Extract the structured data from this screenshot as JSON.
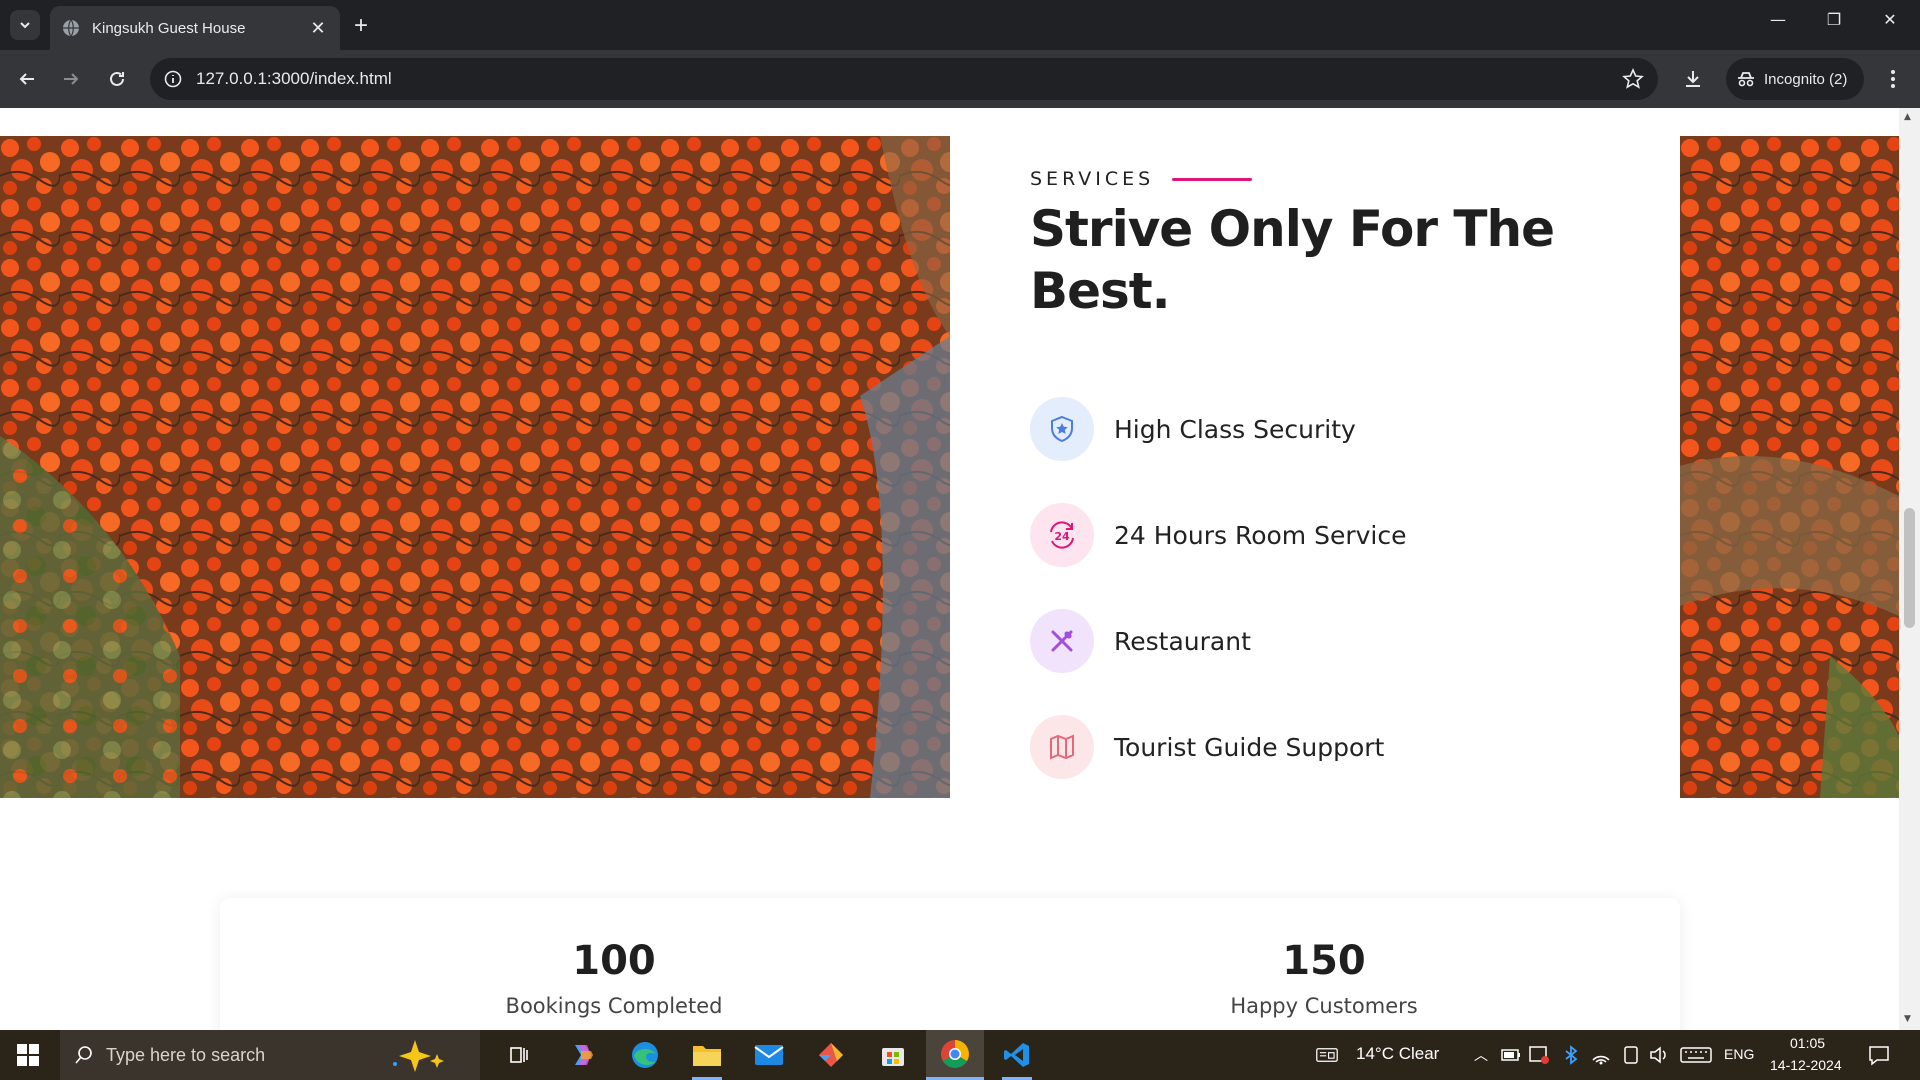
{
  "browser": {
    "tab_title": "Kingsukh Guest House",
    "url": "127.0.0.1:3000/index.html",
    "incognito_label": "Incognito (2)"
  },
  "page": {
    "eyebrow": "SERVICES",
    "headline_line1": "Strive Only For The",
    "headline_line2": "Best.",
    "services": [
      {
        "label": "High Class Security",
        "icon": "shield-star-icon",
        "bg": "#e3edfc",
        "color": "#4b7be5"
      },
      {
        "label": "24 Hours Room Service",
        "icon": "24-hours-icon",
        "bg": "#fde4ef",
        "color": "#e0157a"
      },
      {
        "label": "Restaurant",
        "icon": "fork-knife-icon",
        "bg": "#f1e3fc",
        "color": "#a34ee0"
      },
      {
        "label": "Tourist Guide Support",
        "icon": "map-icon",
        "bg": "#fde6e8",
        "color": "#e26a7a"
      }
    ],
    "stats": [
      {
        "value": "100",
        "label": "Bookings Completed"
      },
      {
        "value": "150",
        "label": "Happy Customers"
      }
    ],
    "accent_color": "#e0157a"
  },
  "taskbar": {
    "search_placeholder": "Type here to search",
    "weather": "14°C  Clear",
    "language": "ENG",
    "time": "01:05",
    "date": "14-12-2024"
  }
}
